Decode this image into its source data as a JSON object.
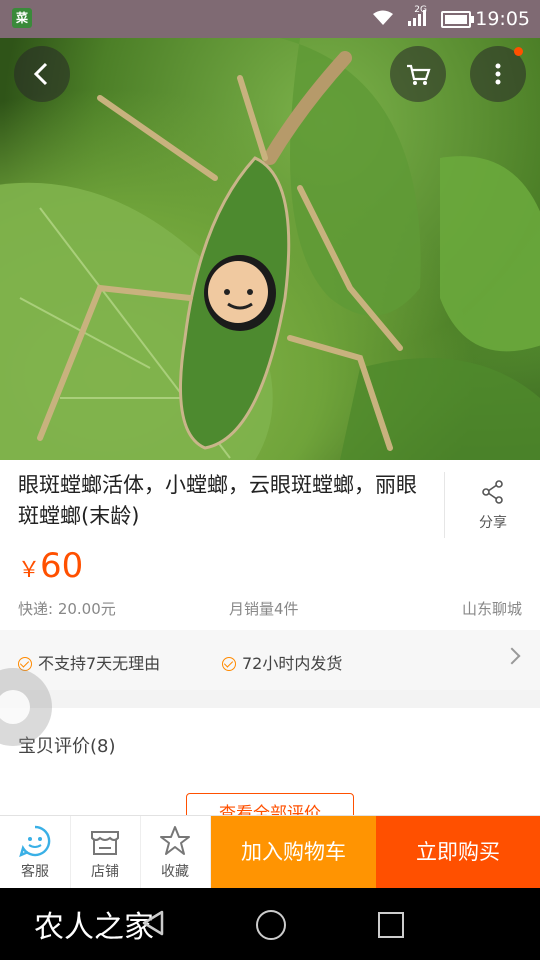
{
  "status_bar": {
    "time": "19:05",
    "network": "2G",
    "app_icon": "app-notification-icon"
  },
  "hero": {
    "image": "mantis-on-leaf-photo",
    "slides": 2,
    "active_slide": 2
  },
  "product": {
    "title": "眼斑螳螂活体，小螳螂，云眼斑螳螂，丽眼斑螳螂(末龄)",
    "share_label": "分享",
    "price_symbol": "￥",
    "price": "60",
    "shipping": "快递: 20.00元",
    "monthly_sales": "月销量4件",
    "location": "山东聊城"
  },
  "services": [
    {
      "label": "不支持7天无理由"
    },
    {
      "label": "72小时内发货"
    }
  ],
  "reviews": {
    "label": "宝贝评价(8)",
    "view_all": "查看全部评价"
  },
  "bottom_bar": {
    "customer_service": "客服",
    "shop": "店铺",
    "favorite": "收藏",
    "add_to_cart": "加入购物车",
    "buy_now": "立即购买"
  },
  "watermark": "农人之家",
  "colors": {
    "accent": "#ff5000",
    "cart": "#ff9402",
    "icon_blue": "#3ab0e6"
  }
}
